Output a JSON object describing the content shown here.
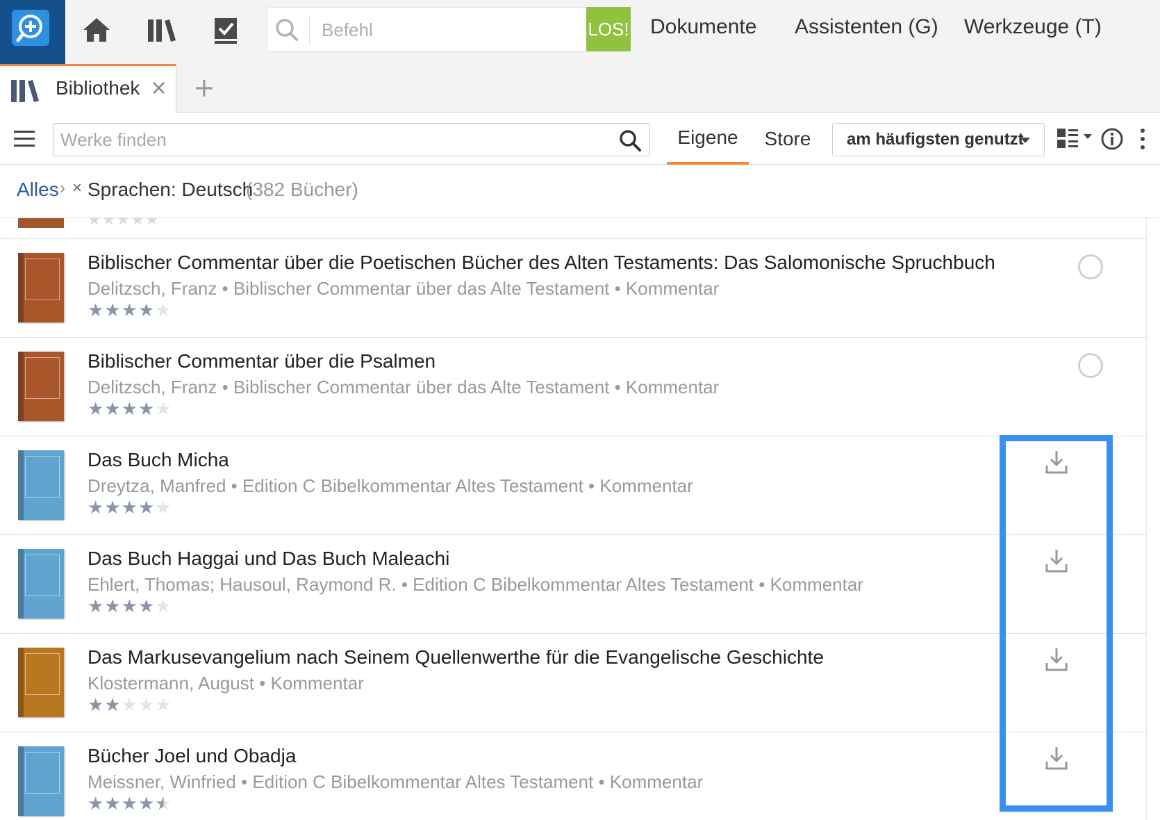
{
  "colors": {
    "accent": "#f0873a",
    "los": "#8fc33f",
    "logo_bg": "#14508c",
    "link": "#2a5d9f",
    "highlight": "#3b8ff0"
  },
  "topbar": {
    "command_placeholder": "Befehl",
    "go_label": "LOS!",
    "menu": [
      "Dokumente",
      "Assistenten (G)",
      "Werkzeuge (T)"
    ]
  },
  "tab": {
    "label": "Bibliothek",
    "close": "×",
    "add": "+"
  },
  "toolbar": {
    "search_placeholder": "Werke finden",
    "view_tabs": [
      "Eigene",
      "Store"
    ],
    "sort_value": "am häufigsten genutzt"
  },
  "breadcrumb": {
    "all": "Alles",
    "separator": "›",
    "remove": "×",
    "filter": "Sprachen: Deutsch",
    "count": "(382 Bücher)"
  },
  "books": [
    {
      "title": "Biblischer Commentar über die Poetischen Bücher des Alten Testaments: Das Salomonische Spruchbuch",
      "meta": "Delitzsch, Franz • Biblischer Commentar über das Alte Testament • Kommentar",
      "rating": 4,
      "status": "circle",
      "cover_color": "#a9572a"
    },
    {
      "title": "Biblischer Commentar über die Psalmen",
      "meta": "Delitzsch, Franz • Biblischer Commentar über das Alte Testament • Kommentar",
      "rating": 4,
      "status": "circle",
      "cover_color": "#a9572a"
    },
    {
      "title": "Das Buch Micha",
      "meta": "Dreytza, Manfred • Edition C Bibelkommentar Altes Testament • Kommentar",
      "rating": 4,
      "status": "download",
      "cover_color": "#5fa3cf"
    },
    {
      "title": "Das Buch Haggai und Das Buch Maleachi",
      "meta": "Ehlert, Thomas; Hausoul, Raymond R. • Edition C Bibelkommentar Altes Testament • Kommentar",
      "rating": 4,
      "status": "download",
      "cover_color": "#5fa3cf"
    },
    {
      "title": "Das Markusevangelium nach Seinem Quellenwerthe für die Evangelische Geschichte",
      "meta": "Klostermann, August • Kommentar",
      "rating": 2,
      "status": "download",
      "cover_color": "#b8761e"
    },
    {
      "title": "Bücher Joel und Obadja",
      "meta": "Meissner, Winfried • Edition C Bibelkommentar Altes Testament • Kommentar",
      "rating": 4.5,
      "status": "download",
      "cover_color": "#5fa3cf"
    }
  ]
}
